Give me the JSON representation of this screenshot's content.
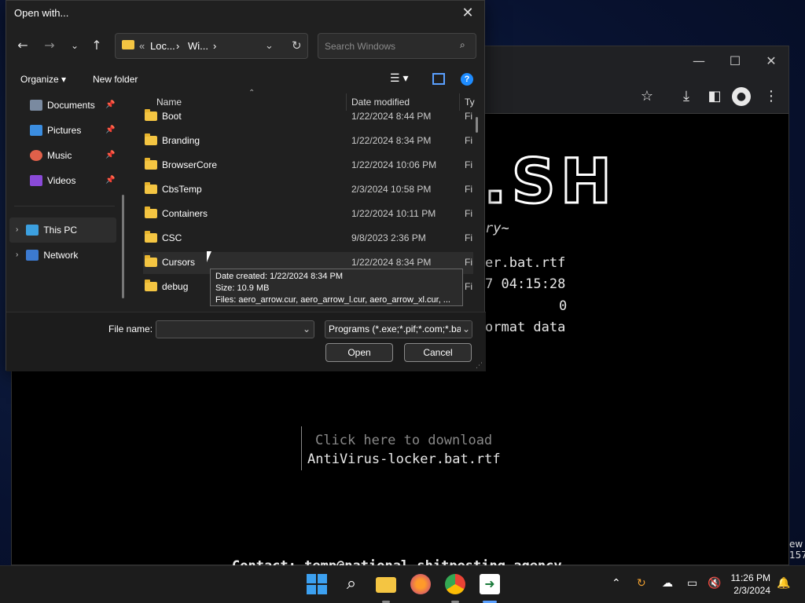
{
  "dialog": {
    "title": "Open with...",
    "breadcrumb": [
      "«",
      "Loc...",
      "›",
      "Wi...",
      "›"
    ],
    "search_placeholder": "Search Windows",
    "organize_label": "Organize ▾",
    "new_folder_label": "New folder",
    "nav": [
      {
        "label": "Documents",
        "icon": "documents-icon",
        "pinned": true
      },
      {
        "label": "Pictures",
        "icon": "pictures-icon",
        "pinned": true
      },
      {
        "label": "Music",
        "icon": "music-icon",
        "pinned": true
      },
      {
        "label": "Videos",
        "icon": "videos-icon",
        "pinned": true
      },
      {
        "label": "This PC",
        "icon": "this-pc-icon"
      },
      {
        "label": "Network",
        "icon": "network-icon"
      }
    ],
    "columns": {
      "name": "Name",
      "date": "Date modified",
      "type": "Ty"
    },
    "files": [
      {
        "name": "Boot",
        "date": "1/22/2024 8:44 PM",
        "type": "Fi"
      },
      {
        "name": "Branding",
        "date": "1/22/2024 8:34 PM",
        "type": "Fi"
      },
      {
        "name": "BrowserCore",
        "date": "1/22/2024 10:06 PM",
        "type": "Fi"
      },
      {
        "name": "CbsTemp",
        "date": "2/3/2024 10:58 PM",
        "type": "Fi"
      },
      {
        "name": "Containers",
        "date": "1/22/2024 10:11 PM",
        "type": "Fi"
      },
      {
        "name": "CSC",
        "date": "9/8/2023 2:36 PM",
        "type": "Fi"
      },
      {
        "name": "Cursors",
        "date": "1/22/2024 8:34 PM",
        "type": "Fi"
      },
      {
        "name": "debug",
        "date": "",
        "type": "Fi"
      }
    ],
    "tooltip": {
      "line1": "Date created: 1/22/2024 8:34 PM",
      "line2": "Size: 10.9 MB",
      "line3": "Files: aero_arrow.cur, aero_arrow_l.cur, aero_arrow_xl.cur, ..."
    },
    "file_name_label": "File name:",
    "file_name_value": "",
    "file_type_value": "Programs (*.exe;*.pif;*.com;*.ba",
    "open_label": "Open",
    "cancel_label": "Cancel"
  },
  "browser": {
    "logo_text": ".SH",
    "line_tagline": "ry~",
    "line_file": "er.bat.rtf",
    "line_time": "7 04:15:28",
    "line_zero": "0",
    "line_format": "ormat data",
    "download_hint": "Click here to download",
    "download_file": "AntiVirus-locker.bat.rtf",
    "contact": "Contact: temp@national_shitposting_agency"
  },
  "desktop": {
    "edge_text_1": "ew",
    "edge_text_2": "157"
  },
  "taskbar": {
    "time": "11:26 PM",
    "date": "2/3/2024"
  }
}
